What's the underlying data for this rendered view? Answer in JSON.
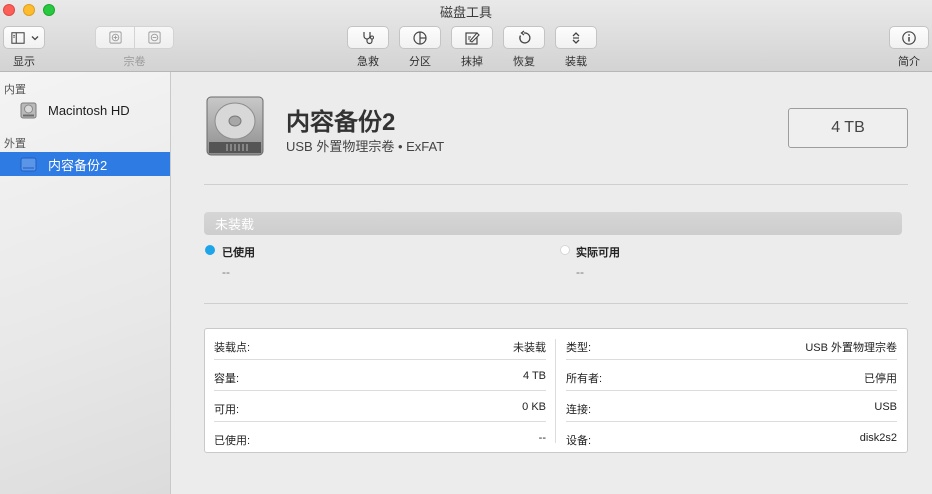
{
  "window": {
    "title": "磁盘工具"
  },
  "toolbar": {
    "view_label": "显示",
    "volume_label": "宗卷",
    "first_aid": "急救",
    "partition": "分区",
    "erase": "抹掉",
    "restore": "恢复",
    "mount": "装载",
    "info": "简介"
  },
  "sidebar": {
    "internal_header": "内置",
    "external_header": "外置",
    "items": [
      {
        "label": "Macintosh HD",
        "icon": "internal-disk-icon"
      },
      {
        "label": "内容备份2",
        "icon": "external-disk-icon"
      }
    ]
  },
  "volume": {
    "name": "内容备份2",
    "subtitle": "USB 外置物理宗卷 • ExFAT",
    "size": "4 TB",
    "status_bar": "未装载",
    "used_label": "已使用",
    "used_value": "--",
    "available_label": "实际可用",
    "available_value": "--",
    "used_color": "#1ea4e9",
    "free_color": "#ffffff"
  },
  "details": {
    "left": [
      {
        "key": "装载点:",
        "value": "未装载"
      },
      {
        "key": "容量:",
        "value": "4 TB"
      },
      {
        "key": "可用:",
        "value": "0 KB"
      },
      {
        "key": "已使用:",
        "value": "--"
      }
    ],
    "right": [
      {
        "key": "类型:",
        "value": "USB 外置物理宗卷"
      },
      {
        "key": "所有者:",
        "value": "已停用"
      },
      {
        "key": "连接:",
        "value": "USB"
      },
      {
        "key": "设备:",
        "value": "disk2s2"
      }
    ]
  }
}
